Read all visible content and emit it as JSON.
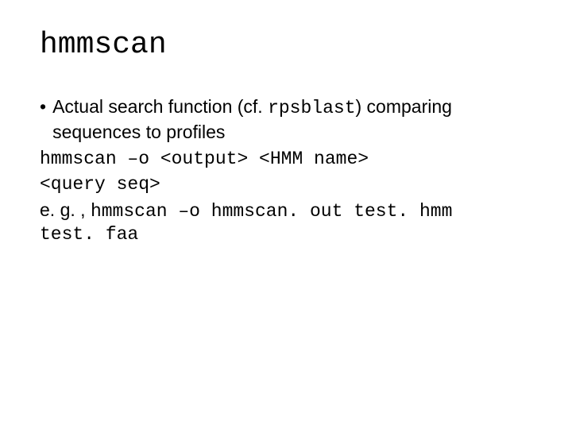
{
  "title": "hmmscan",
  "bullet": "•",
  "description_part1": "Actual search function (cf. ",
  "description_rpsblast": "rpsblast",
  "description_part2": ") comparing sequences to profiles",
  "command_line1": "hmmscan –o <output> <HMM name>",
  "command_line2": "<query seq>",
  "example_prefix": "e. g. , ",
  "example_cmd1": "hmmscan –o hmmscan. out test. hmm",
  "example_cmd2": "test. faa"
}
